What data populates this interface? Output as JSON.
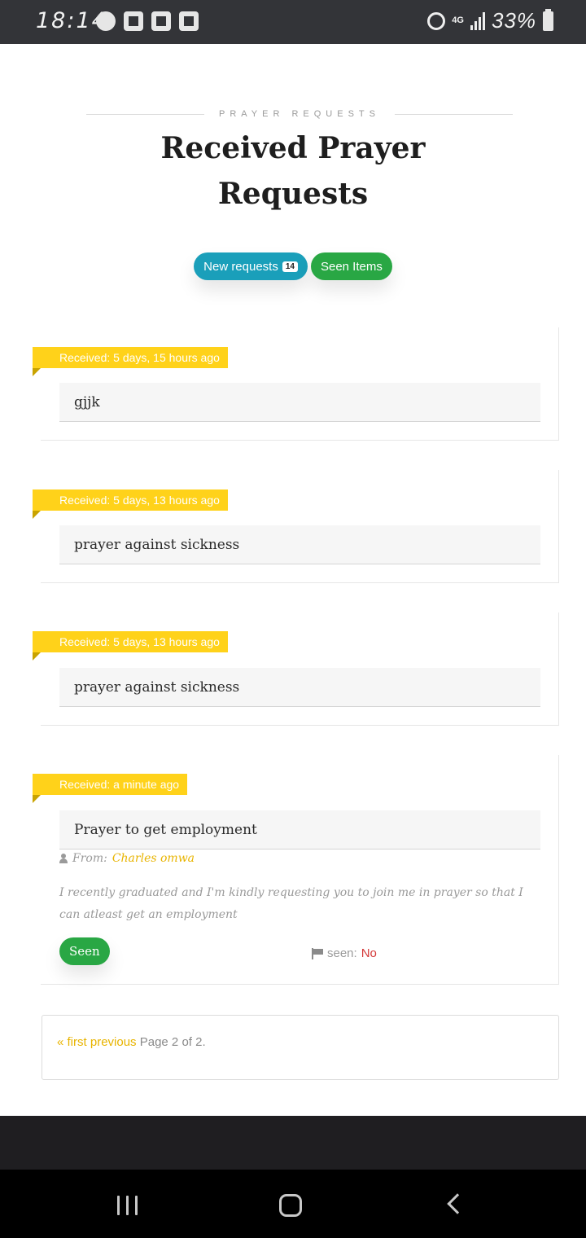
{
  "status_bar": {
    "time": "18:14",
    "network": "4G",
    "battery": "33%",
    "icons": [
      "whatsapp-icon",
      "gmail-icon",
      "check-icon",
      "gallery-icon",
      "alarm-icon",
      "signal-icon",
      "battery-icon"
    ]
  },
  "header": {
    "subtitle": "PRAYER REQUESTS",
    "title": "Received Prayer Requests"
  },
  "filters": {
    "new_label": "New requests",
    "new_count": "14",
    "seen_label": "Seen Items"
  },
  "requests": [
    {
      "received": "Received: 5 days, 15 hours ago",
      "title": "gjjk"
    },
    {
      "received": "Received: 5 days, 13 hours ago",
      "title": "prayer against sickness"
    },
    {
      "received": "Received: 5 days, 13 hours ago",
      "title": "prayer against sickness"
    },
    {
      "received": "Received: a minute ago",
      "title": "Prayer to get employment",
      "from_label": "From:",
      "from_name": "Charles omwa",
      "message": "I recently graduated and I'm kindly requesting you to join me in prayer so that I can atleast get an employment",
      "seen_button": "Seen",
      "seen_label": "seen:",
      "seen_value": "No"
    }
  ],
  "pagination": {
    "first": "« first",
    "previous": "previous",
    "page_text": "Page 2 of 2."
  },
  "colors": {
    "ribbon": "#ffd21a",
    "teal_pill": "#1a9fba",
    "green_pill": "#29a744",
    "link": "#e8b400",
    "status_no": "#d43a3a"
  }
}
